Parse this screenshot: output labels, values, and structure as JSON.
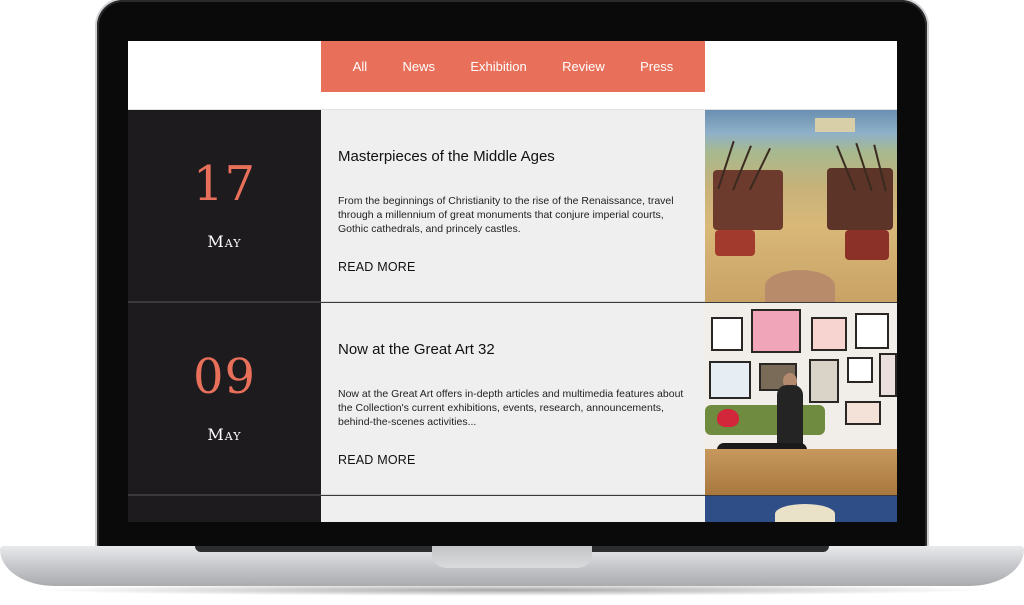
{
  "nav": {
    "items": [
      "All",
      "News",
      "Exhibition",
      "Review",
      "Press"
    ],
    "active": "All"
  },
  "colors": {
    "accent": "#e8705a",
    "date_bg": "#1e1b1e",
    "card_bg": "#efefef"
  },
  "events": [
    {
      "day": "17",
      "month": "May",
      "title": "Masterpieces of the Middle Ages",
      "description": "From the beginnings of Christianity to the rise of the Renaissance, travel through a millennium of great monuments that conjure imperial courts, Gothic cathedrals, and princely castles.",
      "read_more": "READ MORE",
      "image": "medieval-battle-painting"
    },
    {
      "day": "09",
      "month": "May",
      "title": "Now at the Great Art 32",
      "description": "Now at the Great Art offers in-depth articles and multimedia features about the Collection's current exhibitions, events, research, announcements, behind-the-scenes activities...",
      "read_more": "READ MORE",
      "image": "art-collector-gallery-photo"
    }
  ]
}
